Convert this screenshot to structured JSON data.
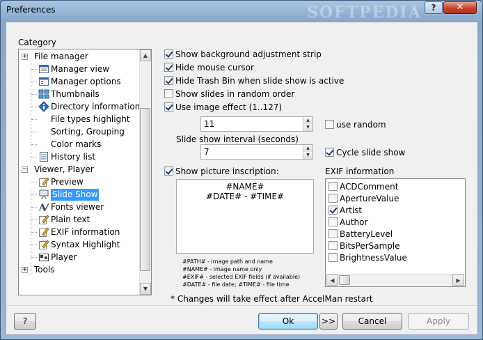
{
  "window": {
    "title": "Preferences",
    "watermark": "SOFTPEDIA",
    "help_glyph": "?",
    "close_glyph": "✕"
  },
  "category": {
    "label": "Category",
    "items": [
      {
        "label": "Manager view",
        "icon": "window-view-icon"
      },
      {
        "label": "Manager options",
        "icon": "window-options-icon"
      },
      {
        "label": "Thumbnails",
        "icon": "thumbnails-icon"
      },
      {
        "label": "Directory information",
        "icon": "info-icon"
      },
      {
        "label": "File types highlight"
      },
      {
        "label": "Sorting, Grouping"
      },
      {
        "label": "Color marks"
      },
      {
        "label": "History list",
        "icon": "list-icon"
      }
    ],
    "file_manager": "File manager",
    "viewer_player": "Viewer, Player",
    "viewer_items": [
      {
        "label": "Preview",
        "icon": "pencil-icon"
      },
      {
        "label": "Slide Show",
        "icon": "slideshow-icon",
        "selected": true
      },
      {
        "label": "Fonts viewer",
        "icon": "fonts-icon"
      },
      {
        "label": "Plain text",
        "icon": "pencil-icon"
      },
      {
        "label": "EXIF information",
        "icon": "pencil-icon"
      },
      {
        "label": "Syntax Highlight",
        "icon": "pencil-icon"
      },
      {
        "label": "Player",
        "icon": "player-icon"
      }
    ],
    "tools": "Tools"
  },
  "options": {
    "show_bg_strip": {
      "label": "Show background adjustment strip",
      "checked": true
    },
    "hide_cursor": {
      "label": "Hide mouse cursor",
      "checked": true
    },
    "hide_trash": {
      "label": "Hide Trash Bin when slide show is active",
      "checked": true
    },
    "random_order": {
      "label": "Show slides in random order",
      "checked": false
    },
    "image_effect": {
      "label": "Use image effect (1..127)",
      "checked": true,
      "value": "11"
    },
    "use_random": {
      "label": "use random",
      "checked": false
    },
    "interval_label": "Slide show interval (seconds)",
    "interval_value": "7",
    "cycle": {
      "label": "Cycle slide show",
      "checked": true
    },
    "inscription": {
      "label": "Show picture inscription:",
      "checked": true,
      "line1": "#NAME#",
      "line2": "#DATE# - #TIME#"
    },
    "legend": [
      "#PATH# - image path and name",
      "#NAME# - image name only",
      "#EXIF# - selected EXIF fields (if available)",
      "#DATE# - file date; #TIME# - file time"
    ]
  },
  "exif": {
    "label": "EXIF information",
    "items": [
      {
        "label": "ACDComment",
        "checked": false
      },
      {
        "label": "ApertureValue",
        "checked": false
      },
      {
        "label": "Artist",
        "checked": true
      },
      {
        "label": "Author",
        "checked": false
      },
      {
        "label": "BatteryLevel",
        "checked": false
      },
      {
        "label": "BitsPerSample",
        "checked": false
      },
      {
        "label": "BrightnessValue",
        "checked": false
      }
    ]
  },
  "note": "* Changes will take effect after AccelMan restart",
  "buttons": {
    "help": "?",
    "ok": "Ok",
    "next": ">>",
    "cancel": "Cancel",
    "apply": "Apply"
  }
}
